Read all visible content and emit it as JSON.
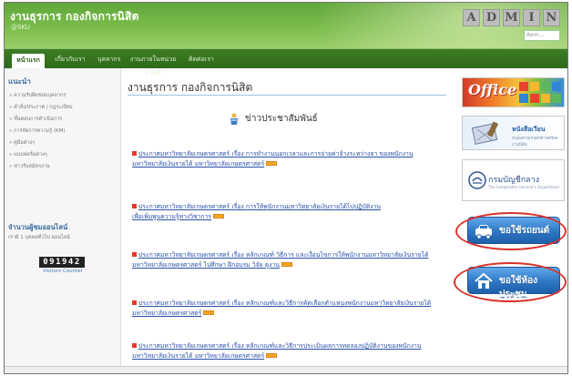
{
  "header": {
    "title": "งานธุรการ กองกิจการนิสิต",
    "subtitle": "@SKU",
    "logo_letters": [
      "A",
      "D",
      "M",
      "I",
      "N"
    ],
    "search_placeholder": "Aem..."
  },
  "nav": {
    "tabs": [
      {
        "label": "หน้าแรก",
        "active": true
      },
      {
        "label": "เกี่ยวกับเรา"
      },
      {
        "label": "บุคลากร"
      },
      {
        "label": "งานภายในหน่วยงานที่"
      },
      {
        "label": "ติดต่อเรา"
      }
    ]
  },
  "sidebar": {
    "heading": "แนะนำ",
    "items": [
      "» ความรับผิดชอบบุคลากร",
      "» คำสั่ง/ประกาศ / กฎระเบียบ",
      "» ขั้นตอนการดำเนินการ",
      "» การจัดการความรู้ (KM)",
      "» คู่มือต่างๆ",
      "» แบบฟอร์มต่างๆ",
      "» ข่าวรับสมัครงาน"
    ],
    "online_heading": "จำนวนผู้ชมออนไลน์",
    "online_sub": "เรามี 1 บุคคลทั่วไป ออนไลน์",
    "counter": "091942",
    "counter_label": "Visitors Counter"
  },
  "main": {
    "title": "งานธุรการ กองกิจการนิสิต",
    "news_heading": "ข่าวประชาสัมพันธ์",
    "news": [
      {
        "line1": "ประกาศมหาวิทยาลัยเกษตรศาสตร์ เรื่อง การทำงานนอกเวลาและการจ่ายค่าจ้างระหว่างลา ของพนักงาน",
        "line2": "มหาวิทยาลัยเงินรายได้ มหาวิทยาลัยเกษตรศาสตร์"
      },
      {
        "line1": "ประกาศมหาวิทยาลัยเกษตรศาสตร์ เรื่อง การให้พนักงานมหาวิทยาลัยเงินรายได้ไปปฏิบัติงาน",
        "line2": "เพื่อเพิ่มพูนความรู้ทางวิชาการ"
      },
      {
        "line1": "ประกาศมหาวิทยาลัยเกษตรศาสตร์ เรื่อง หลักเกณฑ์ วิธีการ และเงื่อนไขการให้พนักงานมหาวิทยาลัยเงินรายได้",
        "line2": "มหาวิทยาลัยเกษตรศาสตร์ ไปศึกษา ฝึกอบรม วิจัย ดูงาน"
      },
      {
        "line1": "ประกาศมหาวิทยาลัยเกษตรศาสตร์ เรื่อง หลักเกณฑ์และวิธีการคัดเลือกตำแหน่งพนักงานมหาวิทยาลัยเงินรายได้",
        "line2": "มหาวิทยาลัยเกษตรศาสตร์"
      },
      {
        "line1": "ประกาศมหาวิทยาลัยเกษตรศาสตร์ เรื่อง หลักเกณฑ์และวิธีการประเมินผลการทดลองปฏิบัติงานของพนักงาน",
        "line2": "มหาวิทยาลัยเงินรายได้ มหาวิทยาลัยเกษตรศาสตร์"
      }
    ]
  },
  "banners": {
    "office_label": "Office",
    "letters_label": "หนังสือเวียน",
    "letters_sub": "หนองคายเกษตรศาสตร์ผลงานนิสิต",
    "cgd_label": "กรมบัญชีกลาง",
    "cgd_sub": "The Comptroller General's Department",
    "car_label": "ขอใช้รถยนต์",
    "room_label": "ขอใช้ห้องประชุม"
  },
  "colors": {
    "header_green": "#6fb33f",
    "nav_green": "#2e6a1a",
    "link_blue": "#2a4fa8",
    "button_blue": "#2d76c4",
    "highlight_red": "#d9332c"
  }
}
